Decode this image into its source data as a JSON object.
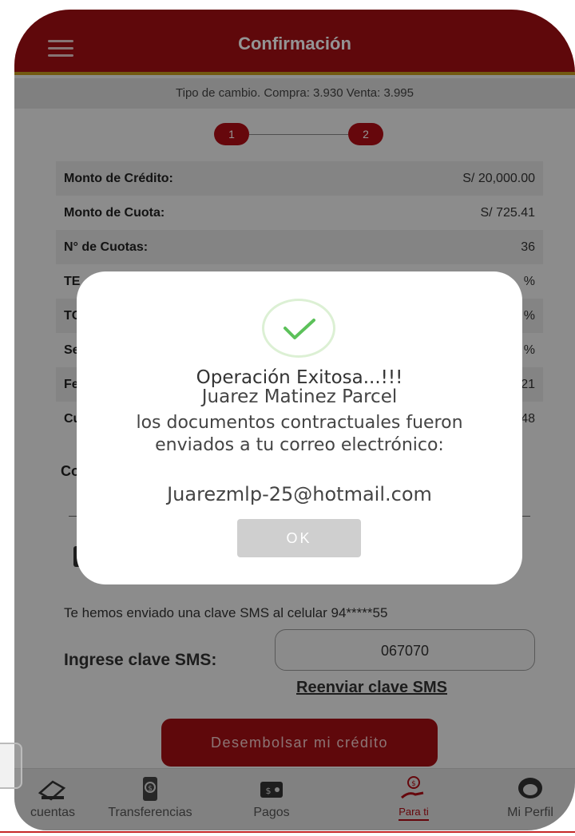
{
  "header": {
    "title": "Confirmación",
    "menu_icon": "hamburger-menu-icon"
  },
  "exchange_rate": "Tipo de cambio. Compra: 3.930 Venta: 3.995",
  "steps": [
    "1",
    "2"
  ],
  "details": [
    {
      "label": "Monto de Crédito:",
      "value": "S/ 20,000.00"
    },
    {
      "label": "Monto de Cuota:",
      "value": "S/ 725.41"
    },
    {
      "label": "N° de Cuotas:",
      "value": "36"
    },
    {
      "label": "TE",
      "value": "%"
    },
    {
      "label": "TC",
      "value": "%"
    },
    {
      "label": "Se",
      "value": "%"
    },
    {
      "label": "Fe",
      "value": "21"
    },
    {
      "label": "Cu",
      "value": "48"
    }
  ],
  "correo_label": "Co",
  "sms": {
    "info": "Te hemos enviado una clave SMS al celular 94*****55",
    "label": "Ingrese clave SMS:",
    "value": "067070",
    "resend": "Reenviar clave SMS"
  },
  "primary_button": "Desembolsar mi crédito",
  "tabs": [
    {
      "label": "cuentas",
      "icon": "card-icon"
    },
    {
      "label": "Transferencias",
      "icon": "phone-transfer-icon"
    },
    {
      "label": "Pagos",
      "icon": "wallet-icon"
    },
    {
      "label": "Para ti",
      "icon": "hand-coin-icon",
      "active": true
    },
    {
      "label": "Mi Perfil",
      "icon": "profile-icon"
    }
  ],
  "modal": {
    "title": "Operación Exitosa...!!!",
    "name": "Juarez Matinez Parcel",
    "message": "los documentos contractuales fueron enviados a tu correo electrónico:",
    "email": "Juarezmlp-25@hotmail.com",
    "ok_label": "OK"
  },
  "colors": {
    "brand_red": "#a40e14",
    "gold_accent": "#c79a1e",
    "success_green": "#4caf50"
  }
}
